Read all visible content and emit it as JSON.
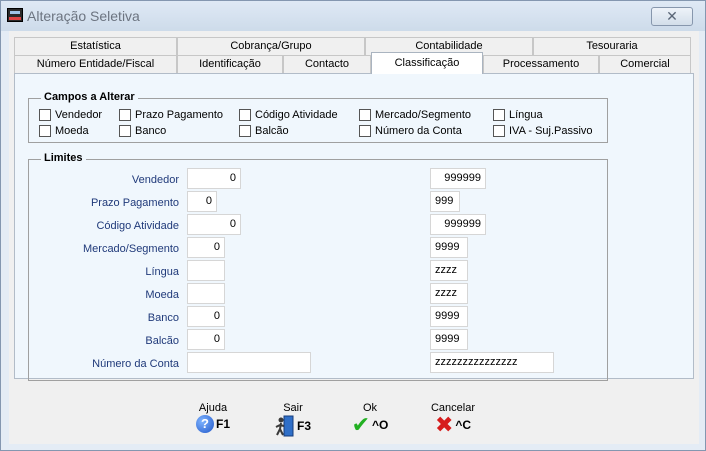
{
  "window": {
    "title": "Alteração Seletiva"
  },
  "tabs_row1": [
    "Estatística",
    "Cobrança/Grupo",
    "Contabilidade",
    "Tesouraria"
  ],
  "tabs_row2": [
    "Número Entidade/Fiscal",
    "Identificação",
    "Contacto",
    "Classificação",
    "Processamento",
    "Comercial"
  ],
  "active_tab": "Classificação",
  "campos": {
    "title": "Campos a Alterar",
    "items": [
      "Vendedor",
      "Prazo Pagamento",
      "Código Atividade",
      "Mercado/Segmento",
      "Língua",
      "Moeda",
      "Banco",
      "Balcão",
      "Número da Conta",
      "IVA - Suj.Passivo"
    ]
  },
  "limites": {
    "title": "Limites",
    "rows": [
      {
        "label": "Vendedor",
        "from": "0",
        "to": "999999"
      },
      {
        "label": "Prazo Pagamento",
        "from": "0",
        "to": "999"
      },
      {
        "label": "Código Atividade",
        "from": "0",
        "to": "999999"
      },
      {
        "label": "Mercado/Segmento",
        "from": "0",
        "to": "9999"
      },
      {
        "label": "Língua",
        "from": "",
        "to": "zzzz"
      },
      {
        "label": "Moeda",
        "from": "",
        "to": "zzzz"
      },
      {
        "label": "Banco",
        "from": "0",
        "to": "9999"
      },
      {
        "label": "Balcão",
        "from": "0",
        "to": "9999"
      },
      {
        "label": "Número da Conta",
        "from": "",
        "to": "zzzzzzzzzzzzzzz"
      }
    ]
  },
  "buttons": {
    "help": {
      "label": "Ajuda",
      "key": "F1"
    },
    "exit": {
      "label": "Sair",
      "key": "F3"
    },
    "ok": {
      "label": "Ok",
      "key": "^O"
    },
    "cancel": {
      "label": "Cancelar",
      "key": "^C"
    }
  }
}
